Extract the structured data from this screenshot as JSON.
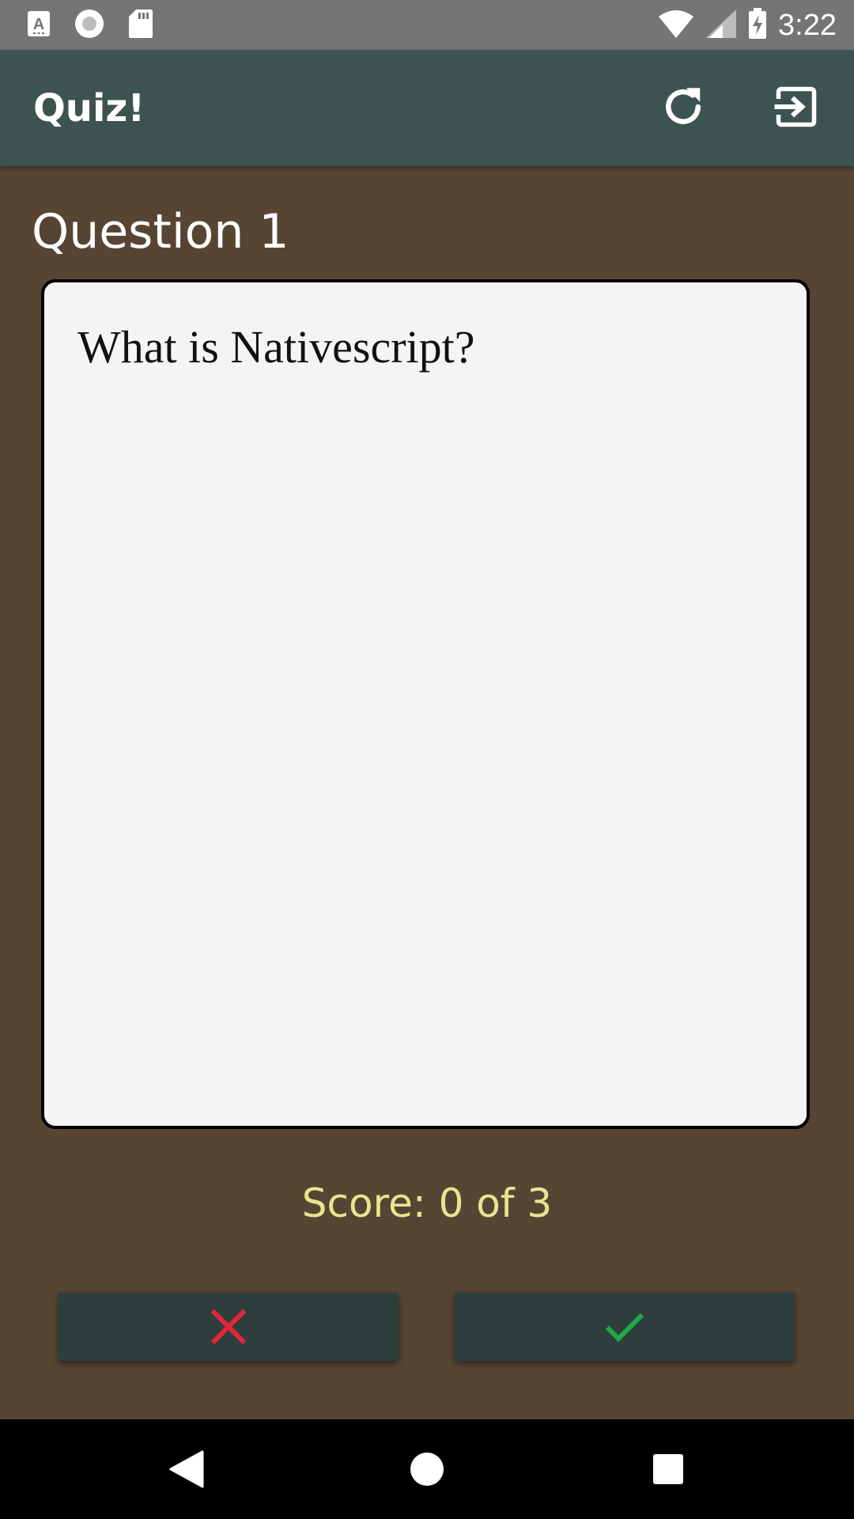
{
  "status_bar": {
    "time": "3:22",
    "left_icons": [
      "keyboard-a-icon",
      "record-icon",
      "sd-card-icon"
    ],
    "right_icons": [
      "wifi-icon",
      "signal-icon",
      "battery-charging-icon"
    ]
  },
  "app_bar": {
    "title": "Quiz!",
    "actions": [
      "refresh-icon",
      "exit-icon"
    ],
    "background": "#3d5350"
  },
  "main": {
    "question_label": "Question 1",
    "question_text": "What is Nativescript?",
    "score": "Score: 0 of 3",
    "background": "#574534",
    "score_color": "#ece38f"
  },
  "answers": {
    "wrong_icon": "cross-icon",
    "wrong_color": "#e3263a",
    "right_icon": "check-icon",
    "right_color": "#21a84a"
  },
  "nav_bar": {
    "buttons": [
      "back-icon",
      "home-icon",
      "recents-icon"
    ]
  }
}
